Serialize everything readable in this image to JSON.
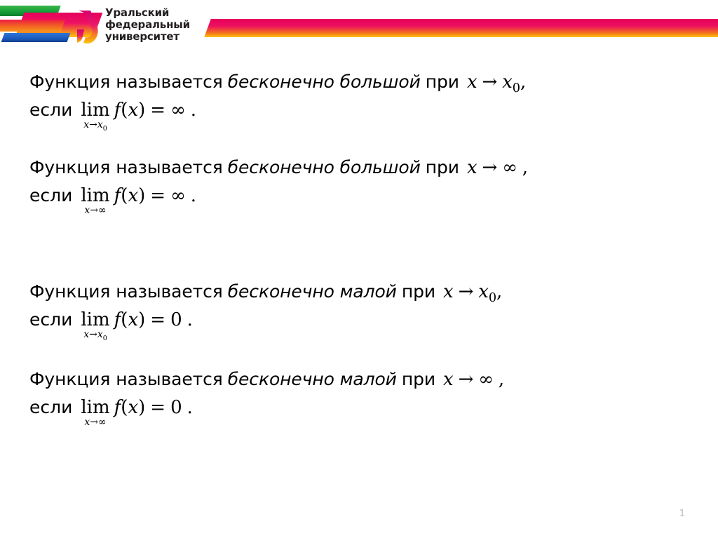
{
  "brand": {
    "logo_lines": [
      "Уральский",
      "федеральный",
      "университет"
    ],
    "logo_mark_name": "ural-federal-university-u-mark",
    "colors": {
      "green": "#17a03a",
      "pink": "#e6005a",
      "orange": "#f36f1d",
      "yellow": "#fdc40b",
      "blue": "#1b5bbd",
      "red": "#ee1c43"
    }
  },
  "slide": {
    "page_number": "1",
    "statements": [
      {
        "lead": "Функция называется",
        "term": "бесконечно большой",
        "mid": "при",
        "arrow_expr": "x → x₀,",
        "arrow_var": "x",
        "arrow": "→",
        "arrow_target": "x",
        "arrow_target_sub": "0",
        "arrow_tail": ",",
        "cond_word": "если",
        "lim_label": "lim",
        "lim_sub": "x→x₀",
        "lim_sub_var": "x",
        "lim_sub_arrow": "→",
        "lim_sub_target": "x",
        "lim_sub_target_sub": "0",
        "body": "f(x) = ∞ .",
        "func_f": "f",
        "func_open": "(",
        "func_var": "x",
        "func_close": ")",
        "equals": "=",
        "result": "∞",
        "period": "."
      },
      {
        "lead": "Функция называется",
        "term": "бесконечно большой",
        "mid": "при",
        "arrow_expr": "x → ∞ ,",
        "arrow_var": "x",
        "arrow": "→",
        "arrow_target": "∞",
        "arrow_target_sub": "",
        "arrow_tail": ",",
        "cond_word": "если",
        "lim_label": "lim",
        "lim_sub": "x→∞",
        "lim_sub_var": "x",
        "lim_sub_arrow": "→",
        "lim_sub_target": "∞",
        "lim_sub_target_sub": "",
        "body": "f(x) = ∞ .",
        "func_f": "f",
        "func_open": "(",
        "func_var": "x",
        "func_close": ")",
        "equals": "=",
        "result": "∞",
        "period": "."
      },
      {
        "lead": "Функция называется",
        "term": "бесконечно малой",
        "mid": "при",
        "arrow_expr": "x → x₀,",
        "arrow_var": "x",
        "arrow": "→",
        "arrow_target": "x",
        "arrow_target_sub": "0",
        "arrow_tail": ",",
        "cond_word": "если",
        "lim_label": "lim",
        "lim_sub": "x→x₀",
        "lim_sub_var": "x",
        "lim_sub_arrow": "→",
        "lim_sub_target": "x",
        "lim_sub_target_sub": "0",
        "body": "f(x) = 0 .",
        "func_f": "f",
        "func_open": "(",
        "func_var": "x",
        "func_close": ")",
        "equals": "=",
        "result": "0",
        "period": "."
      },
      {
        "lead": "Функция называется",
        "term": "бесконечно малой",
        "mid": "при",
        "arrow_expr": "x → ∞ ,",
        "arrow_var": "x",
        "arrow": "→",
        "arrow_target": "∞",
        "arrow_target_sub": "",
        "arrow_tail": ",",
        "cond_word": "если",
        "lim_label": "lim",
        "lim_sub": "x→∞",
        "lim_sub_var": "x",
        "lim_sub_arrow": "→",
        "lim_sub_target": "∞",
        "lim_sub_target_sub": "",
        "body": "f(x) = 0 .",
        "func_f": "f",
        "func_open": "(",
        "func_var": "x",
        "func_close": ")",
        "equals": "=",
        "result": "0",
        "period": "."
      }
    ]
  }
}
